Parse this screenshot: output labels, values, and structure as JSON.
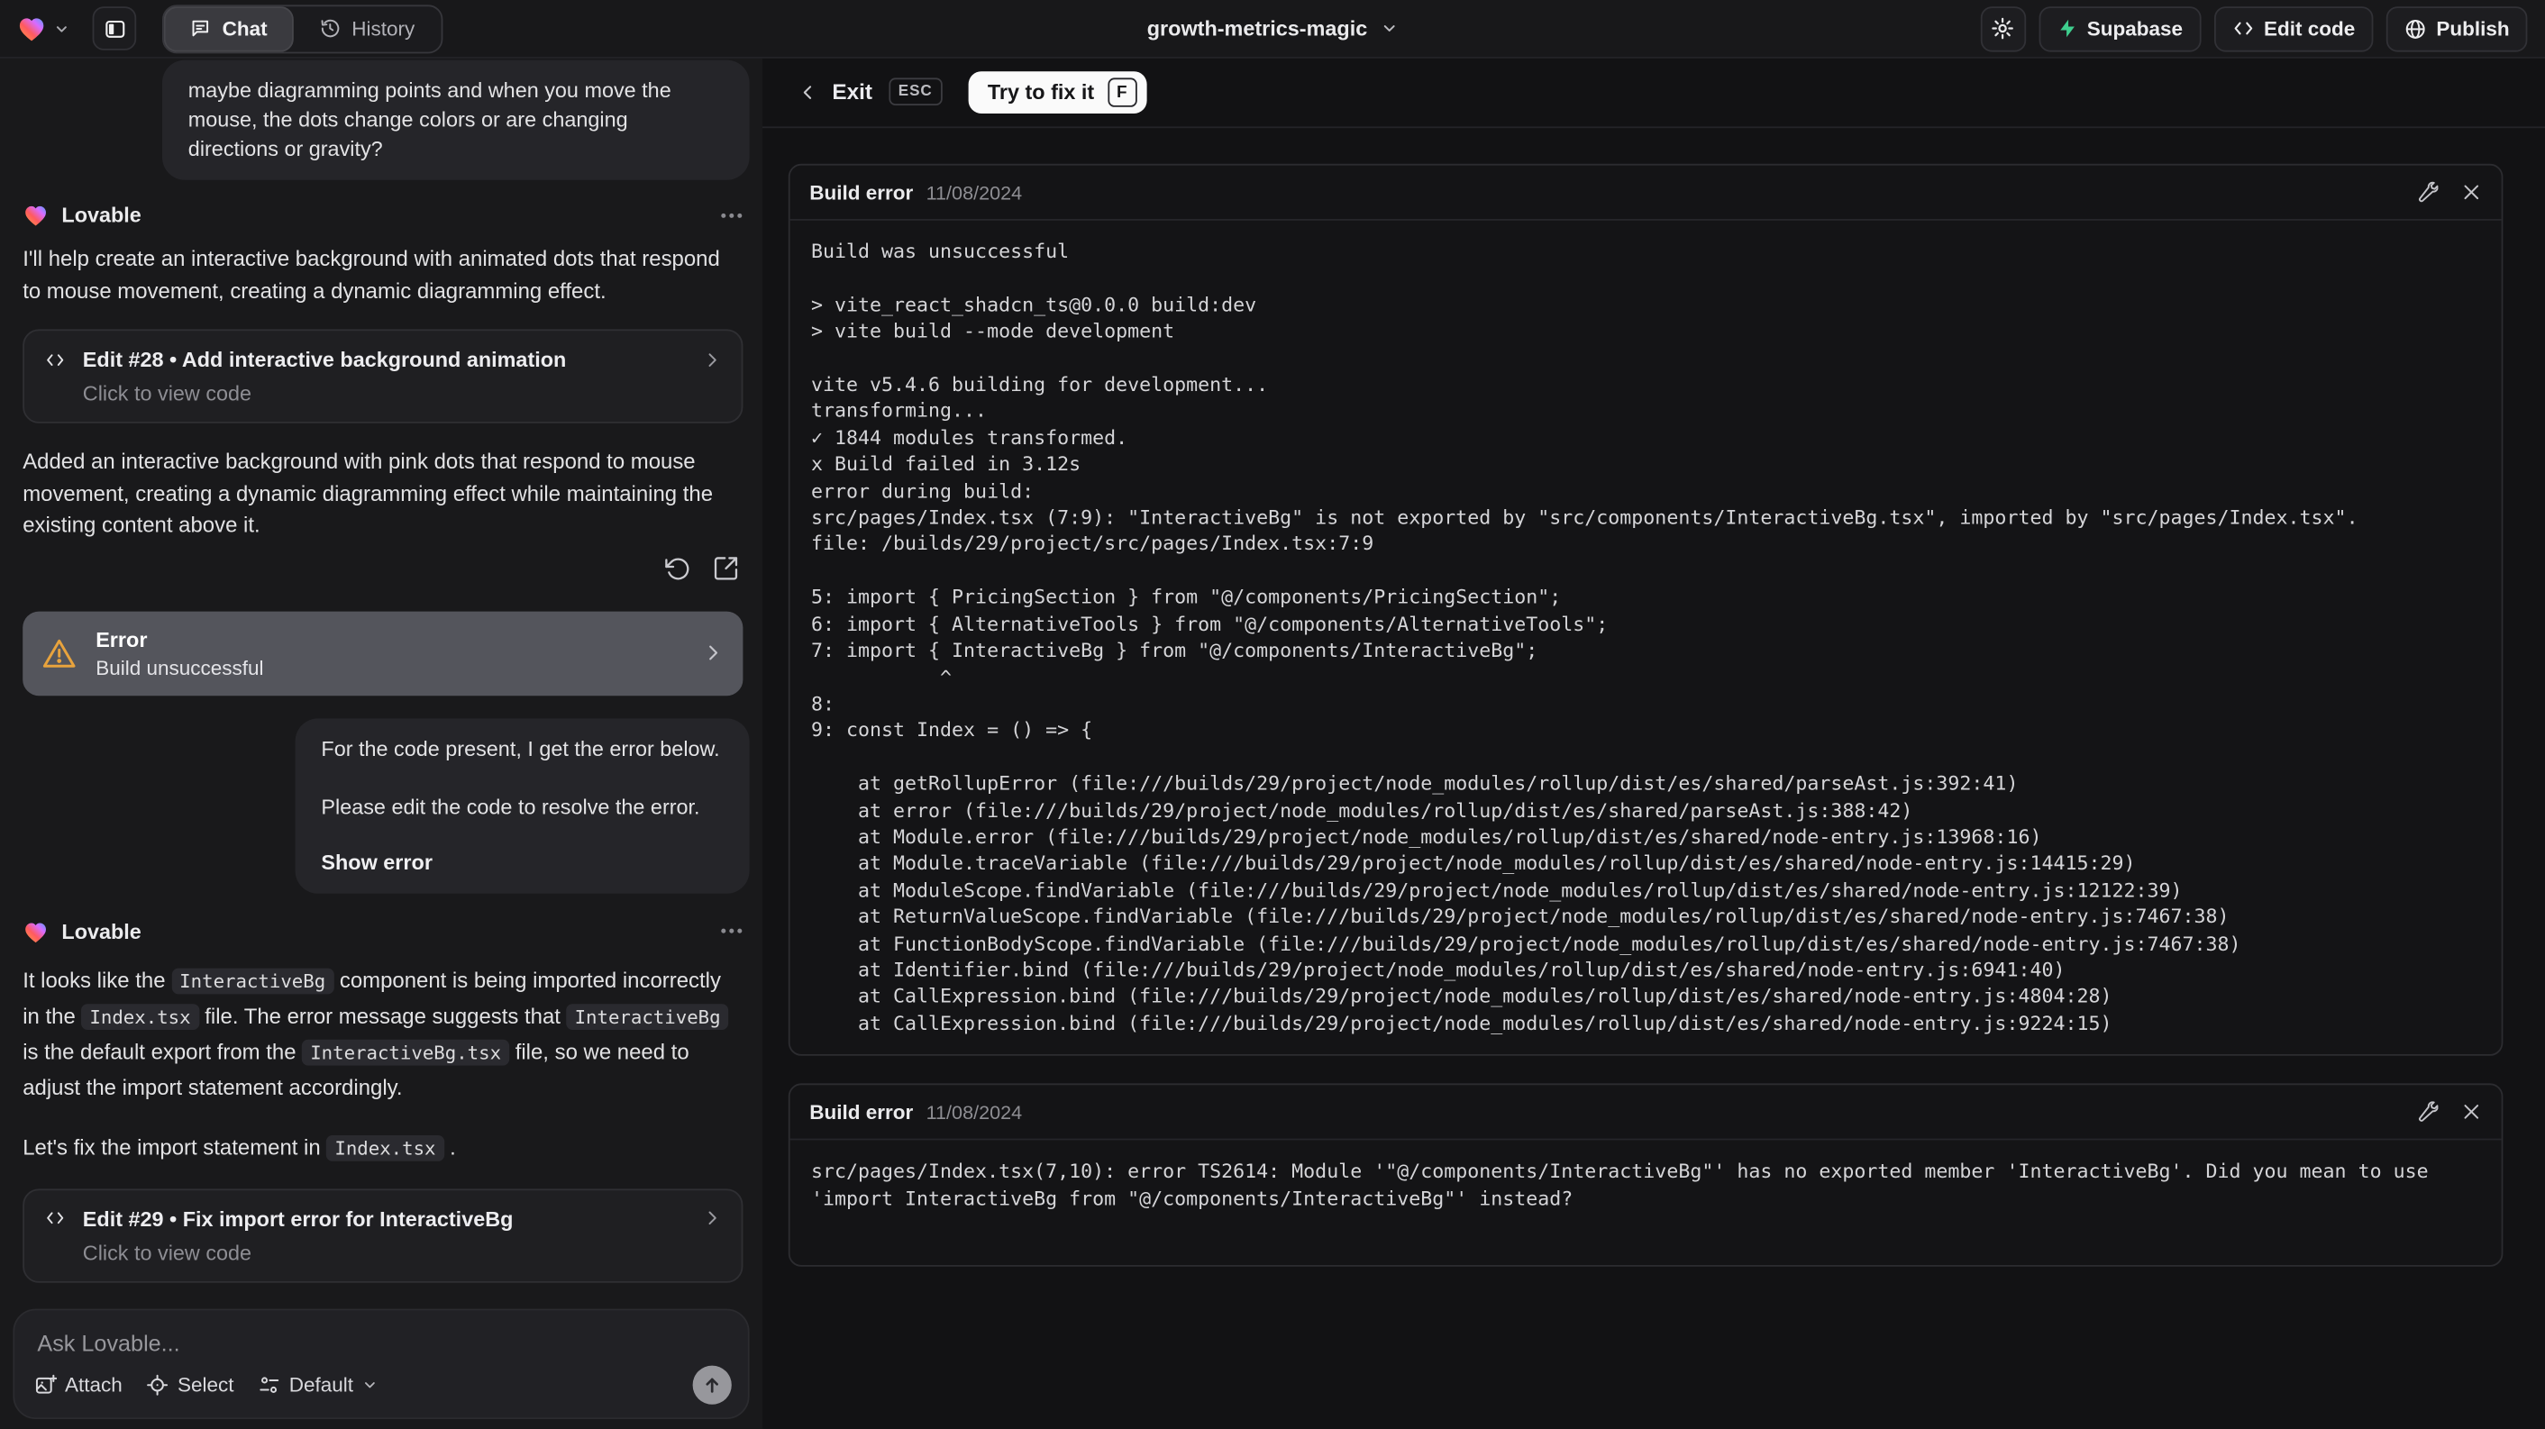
{
  "top_bar": {
    "tab_chat": "Chat",
    "tab_history": "History",
    "project_name": "growth-metrics-magic",
    "supabase_label": "Supabase",
    "edit_code_label": "Edit code",
    "publish_label": "Publish"
  },
  "colors": {
    "accent_amber": "#e8a33d",
    "supabase_green": "#3ecf8e"
  },
  "chat": {
    "assistant_label": "Lovable",
    "user_message_top": "maybe diagramming points and when you move the mouse, the dots change colors or are changing directions or gravity?",
    "msg1": "I'll help create an interactive background with animated dots that respond to mouse movement, creating a dynamic diagramming effect.",
    "edit28": {
      "title": "Edit #28 • Add interactive background animation",
      "subtitle": "Click to view code"
    },
    "msg2": "Added an interactive background with pink dots that respond to mouse movement, creating a dynamic diagramming effect while maintaining the existing content above it.",
    "error_card": {
      "title": "Error",
      "subtitle": "Build unsuccessful"
    },
    "user_error_message": {
      "line1": "For the code present, I get the error below.",
      "line2": "Please edit the code to resolve the error.",
      "action": "Show error"
    },
    "msg3_segments": [
      {
        "t": "It looks like the "
      },
      {
        "c": "InteractiveBg"
      },
      {
        "t": " component is being imported incorrectly in the "
      },
      {
        "c": "Index.tsx"
      },
      {
        "t": " file. The error message suggests that "
      },
      {
        "c": "InteractiveBg"
      },
      {
        "t": " is the default export from the "
      },
      {
        "c": "InteractiveBg.tsx"
      },
      {
        "t": " file, so we need to adjust the import statement accordingly."
      }
    ],
    "msg4_segments": [
      {
        "t": "Let's fix the import statement in "
      },
      {
        "c": "Index.tsx"
      },
      {
        "t": " ."
      }
    ],
    "edit29": {
      "title": "Edit #29 • Fix import error for InteractiveBg",
      "subtitle": "Click to view code"
    },
    "composer": {
      "placeholder": "Ask Lovable...",
      "attach_label": "Attach",
      "select_label": "Select",
      "mode_label": "Default"
    }
  },
  "error_view": {
    "exit_label": "Exit",
    "esc_key": "ESC",
    "fix_button_label": "Try to fix it",
    "fix_key": "F",
    "panels": [
      {
        "title": "Build error",
        "date": "11/08/2024",
        "log": "Build was unsuccessful\n\n> vite_react_shadcn_ts@0.0.0 build:dev\n> vite build --mode development\n\nvite v5.4.6 building for development...\ntransforming...\n✓ 1844 modules transformed.\nx Build failed in 3.12s\nerror during build:\nsrc/pages/Index.tsx (7:9): \"InteractiveBg\" is not exported by \"src/components/InteractiveBg.tsx\", imported by \"src/pages/Index.tsx\".\nfile: /builds/29/project/src/pages/Index.tsx:7:9\n\n5: import { PricingSection } from \"@/components/PricingSection\";\n6: import { AlternativeTools } from \"@/components/AlternativeTools\";\n7: import { InteractiveBg } from \"@/components/InteractiveBg\";\n           ^\n8:\n9: const Index = () => {\n\n    at getRollupError (file:///builds/29/project/node_modules/rollup/dist/es/shared/parseAst.js:392:41)\n    at error (file:///builds/29/project/node_modules/rollup/dist/es/shared/parseAst.js:388:42)\n    at Module.error (file:///builds/29/project/node_modules/rollup/dist/es/shared/node-entry.js:13968:16)\n    at Module.traceVariable (file:///builds/29/project/node_modules/rollup/dist/es/shared/node-entry.js:14415:29)\n    at ModuleScope.findVariable (file:///builds/29/project/node_modules/rollup/dist/es/shared/node-entry.js:12122:39)\n    at ReturnValueScope.findVariable (file:///builds/29/project/node_modules/rollup/dist/es/shared/node-entry.js:7467:38)\n    at FunctionBodyScope.findVariable (file:///builds/29/project/node_modules/rollup/dist/es/shared/node-entry.js:7467:38)\n    at Identifier.bind (file:///builds/29/project/node_modules/rollup/dist/es/shared/node-entry.js:6941:40)\n    at CallExpression.bind (file:///builds/29/project/node_modules/rollup/dist/es/shared/node-entry.js:4804:28)\n    at CallExpression.bind (file:///builds/29/project/node_modules/rollup/dist/es/shared/node-entry.js:9224:15)"
      },
      {
        "title": "Build error",
        "date": "11/08/2024",
        "log": "src/pages/Index.tsx(7,10): error TS2614: Module '\"@/components/InteractiveBg\"' has no exported member 'InteractiveBg'. Did you mean to use 'import InteractiveBg from \"@/components/InteractiveBg\"' instead?"
      }
    ]
  }
}
